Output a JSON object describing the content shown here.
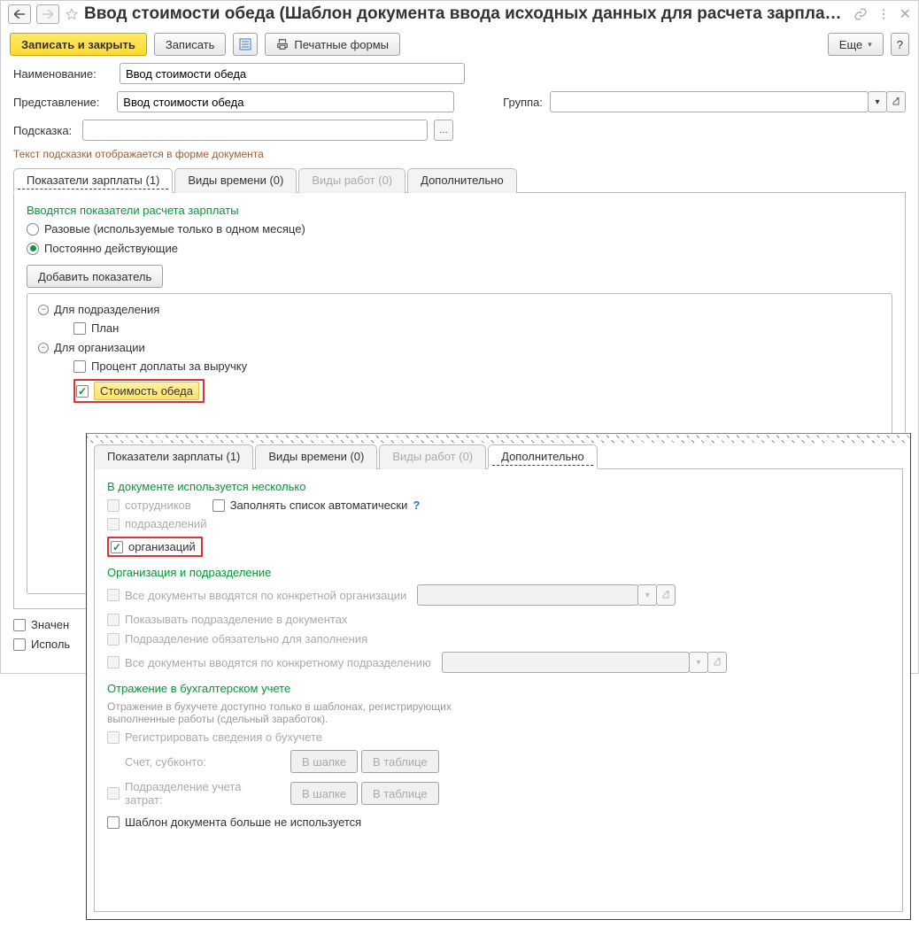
{
  "title": "Ввод стоимости обеда (Шаблон документа ввода исходных данных для расчета зарплаты)",
  "toolbar": {
    "save_close": "Записать и закрыть",
    "save": "Записать",
    "print_forms": "Печатные формы",
    "more": "Еще",
    "help": "?"
  },
  "form": {
    "name_label": "Наименование:",
    "name_value": "Ввод стоимости обеда",
    "repr_label": "Представление:",
    "repr_value": "Ввод стоимости обеда",
    "group_label": "Группа:",
    "hint_label": "Подсказка:",
    "hint_note": "Текст подсказки отображается в форме документа"
  },
  "tabs_main": {
    "t1": "Показатели зарплаты (1)",
    "t2": "Виды времени (0)",
    "t3": "Виды работ (0)",
    "t4": "Дополнительно"
  },
  "indicators": {
    "heading": "Вводятся показатели расчета зарплаты",
    "opt_single": "Разовые (используемые только в одном месяце)",
    "opt_perm": "Постоянно действующие",
    "add_btn": "Добавить показатель",
    "tree": {
      "dept": "Для подразделения",
      "plan": "План",
      "org": "Для организации",
      "percent": "Процент доплаты за выручку",
      "cost": "Стоимость обеда"
    }
  },
  "bottom": {
    "opt1": "Значен",
    "opt2": "Исполь"
  },
  "overlay": {
    "heading1": "В документе используется несколько",
    "ck_employees": "сотрудников",
    "ck_auto": "Заполнять список автоматически",
    "ck_depts": "подразделений",
    "ck_orgs": "организаций",
    "heading2": "Организация и подразделение",
    "ck_docs_by_org": "Все документы вводятся по конкретной организации",
    "ck_show_dept": "Показывать подразделение в документах",
    "ck_dept_required": "Подразделение обязательно для заполнения",
    "ck_docs_by_dept": "Все документы вводятся по конкретному подразделению",
    "heading3": "Отражение в бухгалтерском учете",
    "note3": "Отражение в бухучете доступно только в шаблонах, регистрирующих выполненные работы (сдельный заработок).",
    "ck_reg_acc": "Регистрировать сведения о бухучете",
    "lbl_account": "Счет, субконто:",
    "lbl_dept_cost": "Подразделение учета затрат:",
    "btn_header": "В шапке",
    "btn_table": "В таблице",
    "ck_not_used": "Шаблон документа больше не используется"
  }
}
